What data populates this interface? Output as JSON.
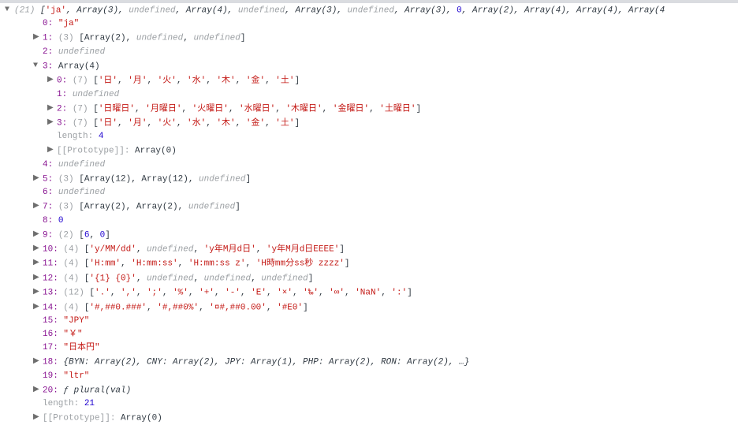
{
  "header": {
    "count": "(21)",
    "summary": "['ja', Array(3), undefined, Array(4), undefined, Array(3), undefined, Array(3), 0, Array(2), Array(4), Array(4), Array(4"
  },
  "rows": [
    {
      "indent": 2,
      "arrow": "",
      "key": "0:",
      "after": [
        {
          "t": "str",
          "v": "\"ja\""
        }
      ]
    },
    {
      "indent": 2,
      "arrow": "▶",
      "key": "1:",
      "after": [
        {
          "t": "greyn",
          "v": "(3) "
        },
        {
          "t": "summary",
          "v": "[Array(2), "
        },
        {
          "t": "grey",
          "v": "undefined"
        },
        {
          "t": "summary",
          "v": ", "
        },
        {
          "t": "grey",
          "v": "undefined"
        },
        {
          "t": "summary",
          "v": "]"
        }
      ]
    },
    {
      "indent": 2,
      "arrow": "",
      "key": "2:",
      "after": [
        {
          "t": "grey",
          "v": "undefined"
        }
      ]
    },
    {
      "indent": 2,
      "arrow": "▼",
      "key": "3:",
      "after": [
        {
          "t": "summary",
          "v": "Array(4)"
        }
      ]
    },
    {
      "indent": 3,
      "arrow": "▶",
      "key": "0:",
      "after": [
        {
          "t": "greyn",
          "v": "(7) "
        },
        {
          "t": "summary",
          "v": "["
        },
        {
          "t": "str",
          "v": "'日'"
        },
        {
          "t": "summary",
          "v": ", "
        },
        {
          "t": "str",
          "v": "'月'"
        },
        {
          "t": "summary",
          "v": ", "
        },
        {
          "t": "str",
          "v": "'火'"
        },
        {
          "t": "summary",
          "v": ", "
        },
        {
          "t": "str",
          "v": "'水'"
        },
        {
          "t": "summary",
          "v": ", "
        },
        {
          "t": "str",
          "v": "'木'"
        },
        {
          "t": "summary",
          "v": ", "
        },
        {
          "t": "str",
          "v": "'金'"
        },
        {
          "t": "summary",
          "v": ", "
        },
        {
          "t": "str",
          "v": "'土'"
        },
        {
          "t": "summary",
          "v": "]"
        }
      ]
    },
    {
      "indent": 3,
      "arrow": "",
      "key": "1:",
      "after": [
        {
          "t": "grey",
          "v": "undefined"
        }
      ]
    },
    {
      "indent": 3,
      "arrow": "▶",
      "key": "2:",
      "after": [
        {
          "t": "greyn",
          "v": "(7) "
        },
        {
          "t": "summary",
          "v": "["
        },
        {
          "t": "str",
          "v": "'日曜日'"
        },
        {
          "t": "summary",
          "v": ", "
        },
        {
          "t": "str",
          "v": "'月曜日'"
        },
        {
          "t": "summary",
          "v": ", "
        },
        {
          "t": "str",
          "v": "'火曜日'"
        },
        {
          "t": "summary",
          "v": ", "
        },
        {
          "t": "str",
          "v": "'水曜日'"
        },
        {
          "t": "summary",
          "v": ", "
        },
        {
          "t": "str",
          "v": "'木曜日'"
        },
        {
          "t": "summary",
          "v": ", "
        },
        {
          "t": "str",
          "v": "'金曜日'"
        },
        {
          "t": "summary",
          "v": ", "
        },
        {
          "t": "str",
          "v": "'土曜日'"
        },
        {
          "t": "summary",
          "v": "]"
        }
      ]
    },
    {
      "indent": 3,
      "arrow": "▶",
      "key": "3:",
      "after": [
        {
          "t": "greyn",
          "v": "(7) "
        },
        {
          "t": "summary",
          "v": "["
        },
        {
          "t": "str",
          "v": "'日'"
        },
        {
          "t": "summary",
          "v": ", "
        },
        {
          "t": "str",
          "v": "'月'"
        },
        {
          "t": "summary",
          "v": ", "
        },
        {
          "t": "str",
          "v": "'火'"
        },
        {
          "t": "summary",
          "v": ", "
        },
        {
          "t": "str",
          "v": "'水'"
        },
        {
          "t": "summary",
          "v": ", "
        },
        {
          "t": "str",
          "v": "'木'"
        },
        {
          "t": "summary",
          "v": ", "
        },
        {
          "t": "str",
          "v": "'金'"
        },
        {
          "t": "summary",
          "v": ", "
        },
        {
          "t": "str",
          "v": "'土'"
        },
        {
          "t": "summary",
          "v": "]"
        }
      ]
    },
    {
      "indent": 3,
      "arrow": "",
      "keygrey": "length:",
      "after": [
        {
          "t": "num",
          "v": "4"
        }
      ]
    },
    {
      "indent": 3,
      "arrow": "▶",
      "keygrey": "[[Prototype]]:",
      "after": [
        {
          "t": "summary",
          "v": "Array(0)"
        }
      ]
    },
    {
      "indent": 2,
      "arrow": "",
      "key": "4:",
      "after": [
        {
          "t": "grey",
          "v": "undefined"
        }
      ]
    },
    {
      "indent": 2,
      "arrow": "▶",
      "key": "5:",
      "after": [
        {
          "t": "greyn",
          "v": "(3) "
        },
        {
          "t": "summary",
          "v": "[Array(12), Array(12), "
        },
        {
          "t": "grey",
          "v": "undefined"
        },
        {
          "t": "summary",
          "v": "]"
        }
      ]
    },
    {
      "indent": 2,
      "arrow": "",
      "key": "6:",
      "after": [
        {
          "t": "grey",
          "v": "undefined"
        }
      ]
    },
    {
      "indent": 2,
      "arrow": "▶",
      "key": "7:",
      "after": [
        {
          "t": "greyn",
          "v": "(3) "
        },
        {
          "t": "summary",
          "v": "[Array(2), Array(2), "
        },
        {
          "t": "grey",
          "v": "undefined"
        },
        {
          "t": "summary",
          "v": "]"
        }
      ]
    },
    {
      "indent": 2,
      "arrow": "",
      "key": "8:",
      "after": [
        {
          "t": "num",
          "v": "0"
        }
      ]
    },
    {
      "indent": 2,
      "arrow": "▶",
      "key": "9:",
      "after": [
        {
          "t": "greyn",
          "v": "(2) "
        },
        {
          "t": "summary",
          "v": "["
        },
        {
          "t": "num",
          "v": "6"
        },
        {
          "t": "summary",
          "v": ", "
        },
        {
          "t": "num",
          "v": "0"
        },
        {
          "t": "summary",
          "v": "]"
        }
      ]
    },
    {
      "indent": 2,
      "arrow": "▶",
      "key": "10:",
      "after": [
        {
          "t": "greyn",
          "v": "(4) "
        },
        {
          "t": "summary",
          "v": "["
        },
        {
          "t": "str",
          "v": "'y/MM/dd'"
        },
        {
          "t": "summary",
          "v": ", "
        },
        {
          "t": "grey",
          "v": "undefined"
        },
        {
          "t": "summary",
          "v": ", "
        },
        {
          "t": "str",
          "v": "'y年M月d日'"
        },
        {
          "t": "summary",
          "v": ", "
        },
        {
          "t": "str",
          "v": "'y年M月d日EEEE'"
        },
        {
          "t": "summary",
          "v": "]"
        }
      ]
    },
    {
      "indent": 2,
      "arrow": "▶",
      "key": "11:",
      "after": [
        {
          "t": "greyn",
          "v": "(4) "
        },
        {
          "t": "summary",
          "v": "["
        },
        {
          "t": "str",
          "v": "'H:mm'"
        },
        {
          "t": "summary",
          "v": ", "
        },
        {
          "t": "str",
          "v": "'H:mm:ss'"
        },
        {
          "t": "summary",
          "v": ", "
        },
        {
          "t": "str",
          "v": "'H:mm:ss z'"
        },
        {
          "t": "summary",
          "v": ", "
        },
        {
          "t": "str",
          "v": "'H時mm分ss秒 zzzz'"
        },
        {
          "t": "summary",
          "v": "]"
        }
      ]
    },
    {
      "indent": 2,
      "arrow": "▶",
      "key": "12:",
      "after": [
        {
          "t": "greyn",
          "v": "(4) "
        },
        {
          "t": "summary",
          "v": "["
        },
        {
          "t": "str",
          "v": "'{1} {0}'"
        },
        {
          "t": "summary",
          "v": ", "
        },
        {
          "t": "grey",
          "v": "undefined"
        },
        {
          "t": "summary",
          "v": ", "
        },
        {
          "t": "grey",
          "v": "undefined"
        },
        {
          "t": "summary",
          "v": ", "
        },
        {
          "t": "grey",
          "v": "undefined"
        },
        {
          "t": "summary",
          "v": "]"
        }
      ]
    },
    {
      "indent": 2,
      "arrow": "▶",
      "key": "13:",
      "after": [
        {
          "t": "greyn",
          "v": "(12) "
        },
        {
          "t": "summary",
          "v": "["
        },
        {
          "t": "str",
          "v": "'.'"
        },
        {
          "t": "summary",
          "v": ", "
        },
        {
          "t": "str",
          "v": "','"
        },
        {
          "t": "summary",
          "v": ", "
        },
        {
          "t": "str",
          "v": "';'"
        },
        {
          "t": "summary",
          "v": ", "
        },
        {
          "t": "str",
          "v": "'%'"
        },
        {
          "t": "summary",
          "v": ", "
        },
        {
          "t": "str",
          "v": "'+'"
        },
        {
          "t": "summary",
          "v": ", "
        },
        {
          "t": "str",
          "v": "'-'"
        },
        {
          "t": "summary",
          "v": ", "
        },
        {
          "t": "str",
          "v": "'E'"
        },
        {
          "t": "summary",
          "v": ", "
        },
        {
          "t": "str",
          "v": "'×'"
        },
        {
          "t": "summary",
          "v": ", "
        },
        {
          "t": "str",
          "v": "'‰'"
        },
        {
          "t": "summary",
          "v": ", "
        },
        {
          "t": "str",
          "v": "'∞'"
        },
        {
          "t": "summary",
          "v": ", "
        },
        {
          "t": "str",
          "v": "'NaN'"
        },
        {
          "t": "summary",
          "v": ", "
        },
        {
          "t": "str",
          "v": "':'"
        },
        {
          "t": "summary",
          "v": "]"
        }
      ]
    },
    {
      "indent": 2,
      "arrow": "▶",
      "key": "14:",
      "after": [
        {
          "t": "greyn",
          "v": "(4) "
        },
        {
          "t": "summary",
          "v": "["
        },
        {
          "t": "str",
          "v": "'#,##0.###'"
        },
        {
          "t": "summary",
          "v": ", "
        },
        {
          "t": "str",
          "v": "'#,##0%'"
        },
        {
          "t": "summary",
          "v": ", "
        },
        {
          "t": "str",
          "v": "'¤#,##0.00'"
        },
        {
          "t": "summary",
          "v": ", "
        },
        {
          "t": "str",
          "v": "'#E0'"
        },
        {
          "t": "summary",
          "v": "]"
        }
      ]
    },
    {
      "indent": 2,
      "arrow": "",
      "key": "15:",
      "after": [
        {
          "t": "str",
          "v": "\"JPY\""
        }
      ]
    },
    {
      "indent": 2,
      "arrow": "",
      "key": "16:",
      "after": [
        {
          "t": "str",
          "v": "\"￥\""
        }
      ]
    },
    {
      "indent": 2,
      "arrow": "",
      "key": "17:",
      "after": [
        {
          "t": "str",
          "v": "\"日本円\""
        }
      ]
    },
    {
      "indent": 2,
      "arrow": "▶",
      "key": "18:",
      "after": [
        {
          "t": "obj",
          "v": "{BYN: Array(2), CNY: Array(2), JPY: Array(1), PHP: Array(2), RON: Array(2), …}"
        }
      ]
    },
    {
      "indent": 2,
      "arrow": "",
      "key": "19:",
      "after": [
        {
          "t": "str",
          "v": "\"ltr\""
        }
      ]
    },
    {
      "indent": 2,
      "arrow": "▶",
      "key": "20:",
      "after": [
        {
          "t": "func",
          "v": "ƒ plural(val)"
        }
      ]
    },
    {
      "indent": 2,
      "arrow": "",
      "keygrey": "length:",
      "after": [
        {
          "t": "num",
          "v": "21"
        }
      ]
    },
    {
      "indent": 2,
      "arrow": "▶",
      "keygrey": "[[Prototype]]:",
      "after": [
        {
          "t": "summary",
          "v": "Array(0)"
        }
      ]
    }
  ]
}
